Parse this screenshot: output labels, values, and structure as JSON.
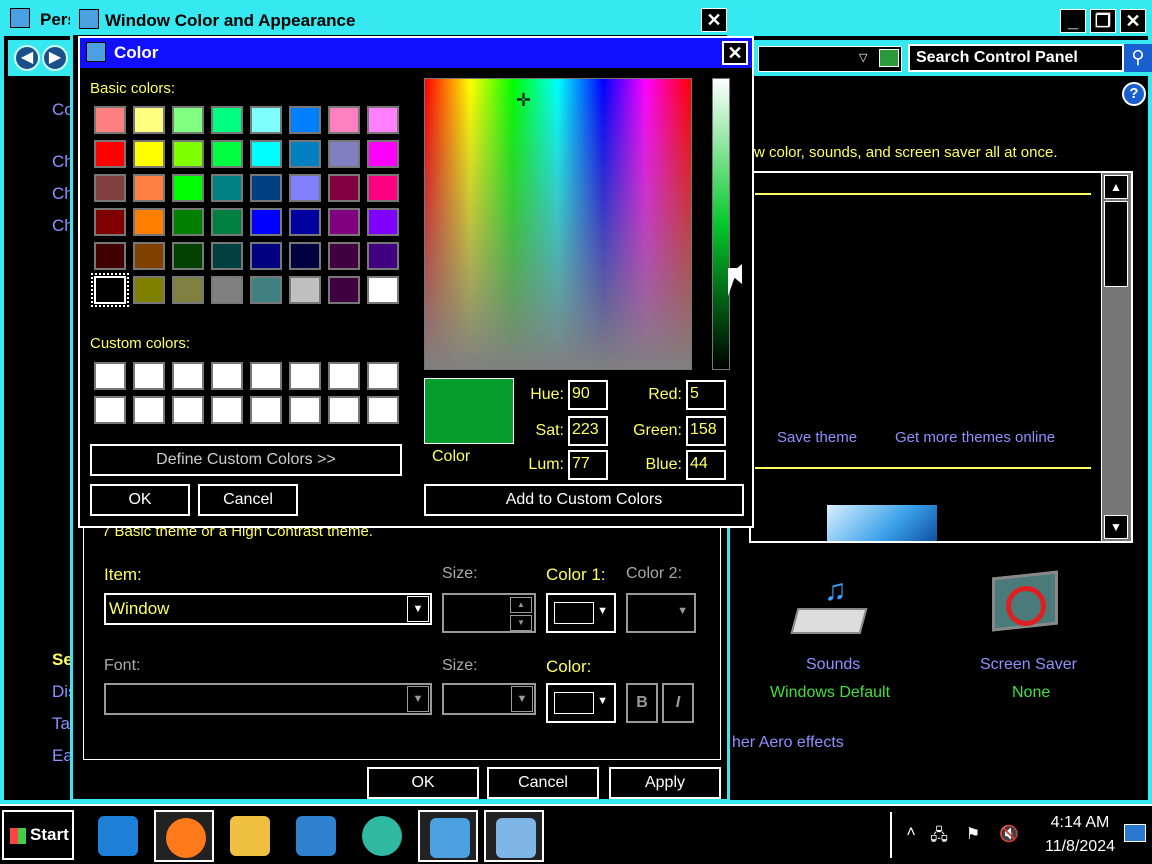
{
  "background_window": {
    "title": "Pers",
    "controls": {
      "minimize": "_",
      "maximize": "❐",
      "close": "✕"
    },
    "search_placeholder": "Search Control Panel",
    "left_links_top": [
      "Co",
      "Ch",
      "Ch",
      "Ch"
    ],
    "see_also_label": "Se",
    "left_links_bottom": [
      "Dis",
      "Tas",
      "Ea"
    ],
    "intro_text": "w color, sounds, and screen saver all at once.",
    "save_theme": "Save theme",
    "get_more_themes": "Get more themes online",
    "sounds_label": "Sounds",
    "sounds_value": "Windows Default",
    "screensaver_label": "Screen Saver",
    "screensaver_value": "None",
    "aero_link": "her Aero effects"
  },
  "wca_dialog": {
    "title": "Window Color and Appearance",
    "close": "✕",
    "description": "7 Basic theme or a High Contrast theme.",
    "item_label": "Item:",
    "item_value": "Window",
    "size_label": "Size:",
    "color1_label": "Color 1:",
    "color2_label": "Color 2:",
    "font_label": "Font:",
    "font_size_label": "Size:",
    "font_color_label": "Color:",
    "bold_label": "B",
    "italic_label": "I",
    "ok": "OK",
    "cancel": "Cancel",
    "apply": "Apply"
  },
  "color_dialog": {
    "title": "Color",
    "close": "✕",
    "basic_colors_label": "Basic colors:",
    "basic_colors": [
      [
        "#ff8080",
        "#ffff80",
        "#80ff80",
        "#00ff80",
        "#80ffff",
        "#0080ff",
        "#ff80c0",
        "#ff80ff"
      ],
      [
        "#ff0000",
        "#ffff00",
        "#80ff00",
        "#00ff40",
        "#00ffff",
        "#0080c0",
        "#8080c0",
        "#ff00ff"
      ],
      [
        "#804040",
        "#ff8040",
        "#00ff00",
        "#008080",
        "#004080",
        "#8080ff",
        "#800040",
        "#ff0080"
      ],
      [
        "#800000",
        "#ff8000",
        "#008000",
        "#008040",
        "#0000ff",
        "#0000a0",
        "#800080",
        "#8000ff"
      ],
      [
        "#400000",
        "#804000",
        "#004000",
        "#004040",
        "#000080",
        "#000040",
        "#400040",
        "#400080"
      ],
      [
        "#000000",
        "#808000",
        "#808040",
        "#808080",
        "#408080",
        "#c0c0c0",
        "#400040",
        "#ffffff"
      ]
    ],
    "selected_basic": {
      "row": 5,
      "col": 0
    },
    "custom_colors_label": "Custom colors:",
    "custom_colors": [
      [
        "#ffffff",
        "#ffffff",
        "#ffffff",
        "#ffffff",
        "#ffffff",
        "#ffffff",
        "#ffffff",
        "#ffffff"
      ],
      [
        "#ffffff",
        "#ffffff",
        "#ffffff",
        "#ffffff",
        "#ffffff",
        "#ffffff",
        "#ffffff",
        "#ffffff"
      ]
    ],
    "define_custom": "Define Custom Colors >>",
    "ok": "OK",
    "cancel": "Cancel",
    "color_label": "Color",
    "current_color": "#059e2c",
    "hue_label": "Hue:",
    "hue": "90",
    "sat_label": "Sat:",
    "sat": "223",
    "lum_label": "Lum:",
    "lum": "77",
    "red_label": "Red:",
    "red": "5",
    "green_label": "Green:",
    "green": "158",
    "blue_label": "Blue:",
    "blue": "44",
    "add_custom": "Add to Custom Colors"
  },
  "taskbar": {
    "start": "Start",
    "time": "4:14 AM",
    "date": "11/8/2024",
    "items": [
      {
        "name": "internet-explorer-icon",
        "color": "#1e7fd8"
      },
      {
        "name": "firefox-icon",
        "color": "#ff7a1a"
      },
      {
        "name": "file-explorer-icon",
        "color": "#f0c040"
      },
      {
        "name": "media-player-icon",
        "color": "#3080d0"
      },
      {
        "name": "app-circle-icon",
        "color": "#2fb9a0"
      },
      {
        "name": "control-panel-icon",
        "color": "#4aa0e0"
      },
      {
        "name": "display-settings-icon",
        "color": "#7fb6e8"
      }
    ]
  }
}
